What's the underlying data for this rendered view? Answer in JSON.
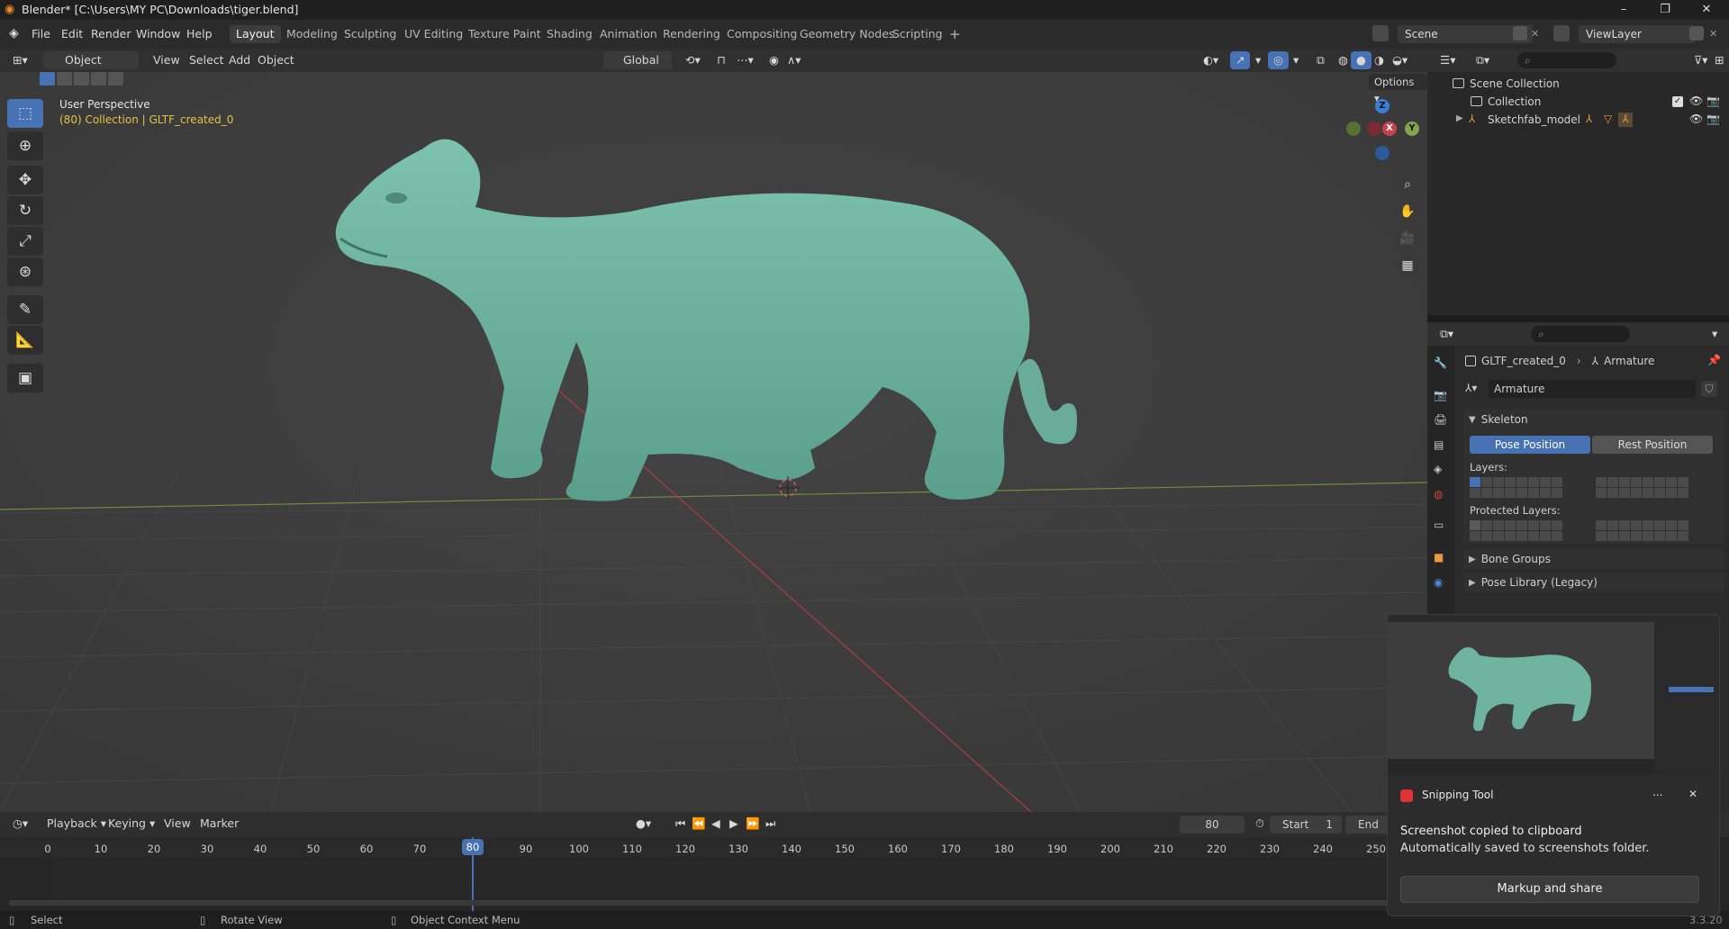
{
  "window": {
    "title": "Blender* [C:\\Users\\MY PC\\Downloads\\tiger.blend]"
  },
  "menu": [
    "File",
    "Edit",
    "Render",
    "Window",
    "Help"
  ],
  "workspaces": [
    "Layout",
    "Modeling",
    "Sculpting",
    "UV Editing",
    "Texture Paint",
    "Shading",
    "Animation",
    "Rendering",
    "Compositing",
    "Geometry Nodes",
    "Scripting"
  ],
  "active_workspace": "Layout",
  "scene": {
    "name": "Scene",
    "view_layer": "ViewLayer"
  },
  "viewport_header": {
    "mode": "Object Mode",
    "menus": [
      "View",
      "Select",
      "Add",
      "Object"
    ],
    "transform_orientation": "Global",
    "options": "Options"
  },
  "viewport": {
    "view_name": "User Perspective",
    "collection_info": "(80) Collection | GLTF_created_0"
  },
  "gizmo_axes": {
    "z": "Z",
    "y": "Y",
    "x": "X"
  },
  "outliner": {
    "root": "Scene Collection",
    "items": [
      {
        "label": "Collection",
        "level": 1
      },
      {
        "label": "Sketchfab_model",
        "level": 1
      }
    ]
  },
  "properties": {
    "breadcrumb_object": "GLTF_created_0",
    "breadcrumb_data": "Armature",
    "datablock_name": "Armature",
    "panels": {
      "skeleton": "Skeleton",
      "pose_position": "Pose Position",
      "rest_position": "Rest Position",
      "layers": "Layers:",
      "protected_layers": "Protected Layers:",
      "bone_groups": "Bone Groups",
      "pose_library": "Pose Library (Legacy)"
    }
  },
  "timeline": {
    "menus": [
      "Playback",
      "Keying",
      "View",
      "Marker"
    ],
    "current_frame": "80",
    "start_label": "Start",
    "start_value": "1",
    "end_label": "End",
    "ticks": [
      "0",
      "10",
      "20",
      "30",
      "40",
      "50",
      "60",
      "70",
      "80",
      "90",
      "100",
      "110",
      "120",
      "130",
      "140",
      "150",
      "160",
      "170",
      "180",
      "190",
      "200",
      "210",
      "220",
      "230",
      "240",
      "250"
    ],
    "playhead": 80
  },
  "statusbar": {
    "select": "Select",
    "rotate": "Rotate View",
    "context": "Object Context Menu",
    "version": "3.3.20"
  },
  "snipping_toast": {
    "app": "Snipping Tool",
    "line1": "Screenshot copied to clipboard",
    "line2": "Automatically saved to screenshots folder.",
    "button": "Markup and share",
    "more": "...",
    "close": "✕"
  },
  "colors": {
    "accent": "#4772b3",
    "tiger": "#6fb4a0",
    "yellow_text": "#e6c244",
    "axis_red": "#c9414e",
    "axis_green": "#7fa84b",
    "axis_blue": "#3b7dd6"
  }
}
